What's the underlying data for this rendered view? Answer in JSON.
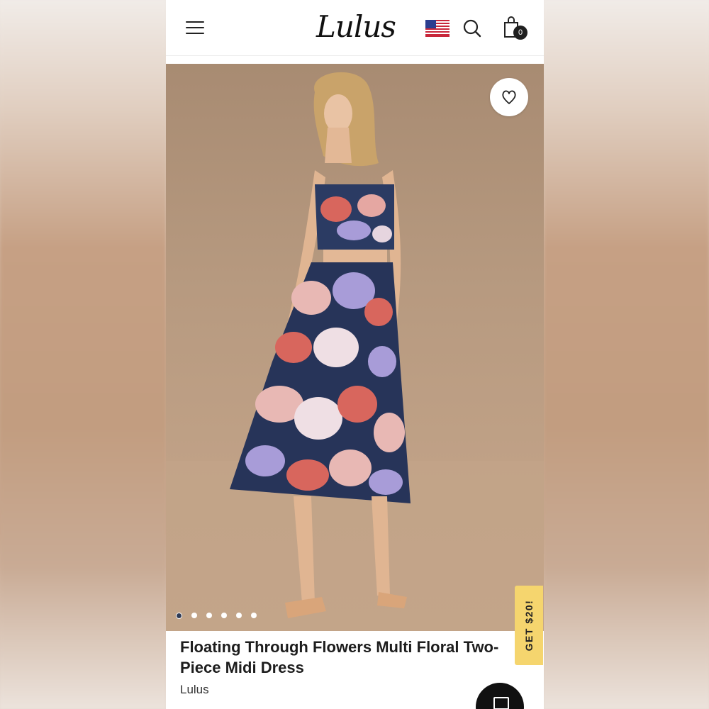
{
  "header": {
    "logo_text": "Lulus",
    "cart_count": "0",
    "icons": [
      "hamburger-menu-icon",
      "us-flag-icon",
      "search-icon",
      "shopping-bag-icon"
    ]
  },
  "gallery": {
    "image_count": 6,
    "active_index": 0,
    "wishlist_icon": "heart-icon"
  },
  "promo": {
    "label": "GET $20!",
    "color": "#f5d56e"
  },
  "product": {
    "title": "Floating Through Flowers Multi Floral Two-Piece Midi Dress",
    "brand": "Lulus"
  },
  "chat": {
    "icon": "chat-icon"
  }
}
